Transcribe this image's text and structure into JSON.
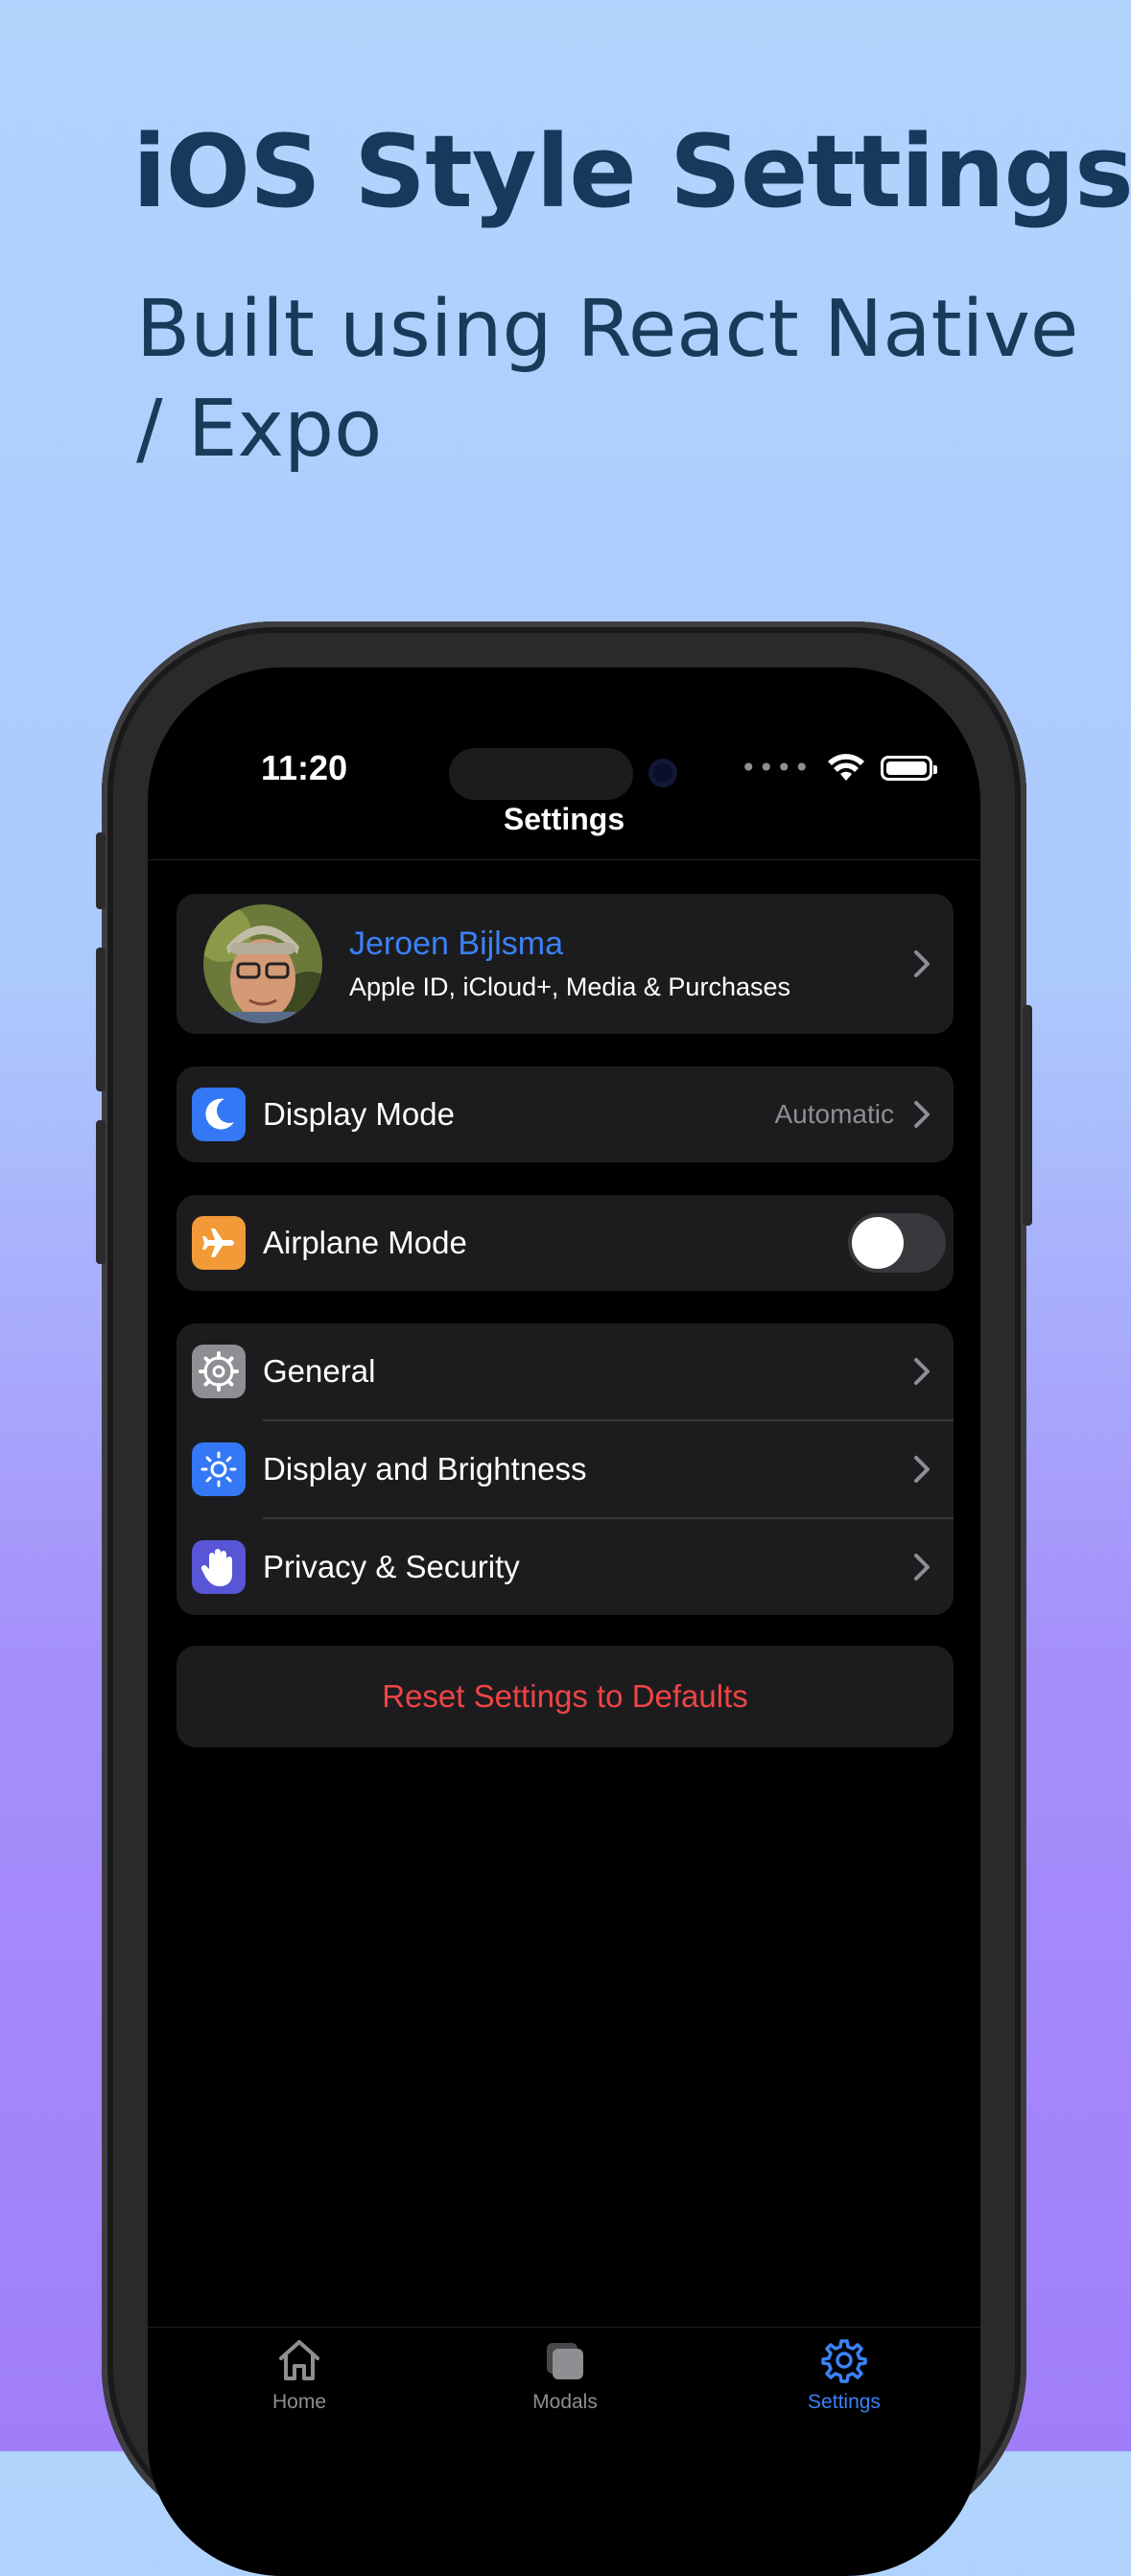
{
  "hero": {
    "title": "iOS Style Settings",
    "subtitle": "Built using React Native / Expo"
  },
  "status_bar": {
    "time": "11:20",
    "signal": "••••"
  },
  "nav": {
    "title": "Settings"
  },
  "profile": {
    "name": "Jeroen Bijlsma",
    "subtitle": "Apple ID, iCloud+, Media & Purchases"
  },
  "display_mode": {
    "label": "Display Mode",
    "value": "Automatic",
    "icon": "moon-icon",
    "icon_bg": "#3478f6"
  },
  "airplane_mode": {
    "label": "Airplane Mode",
    "enabled": false,
    "icon": "airplane-icon",
    "icon_bg": "#f29a38"
  },
  "settings_group": [
    {
      "label": "General",
      "icon": "gear-icon",
      "icon_bg": "#8e8e93"
    },
    {
      "label": "Display and Brightness",
      "icon": "sun-icon",
      "icon_bg": "#3478f6"
    },
    {
      "label": "Privacy & Security",
      "icon": "hand-icon",
      "icon_bg": "#5856d6"
    }
  ],
  "reset": {
    "label": "Reset Settings to Defaults",
    "color": "#ef4444"
  },
  "tabs": [
    {
      "label": "Home",
      "icon": "home-icon",
      "active": false
    },
    {
      "label": "Modals",
      "icon": "modals-icon",
      "active": false
    },
    {
      "label": "Settings",
      "icon": "gear-icon",
      "active": true
    }
  ],
  "colors": {
    "accent": "#3b82f6",
    "destructive": "#ef4444",
    "group_bg": "#1c1c1e"
  }
}
